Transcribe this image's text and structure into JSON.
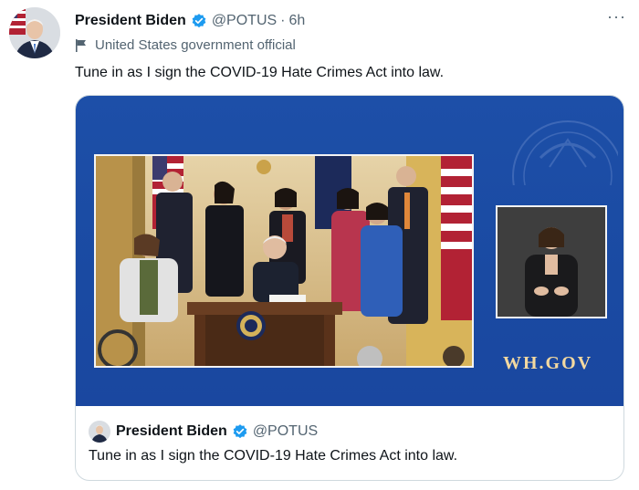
{
  "tweet": {
    "author_name": "President Biden",
    "handle": "@POTUS",
    "separator": "·",
    "time": "6h",
    "more_label": "···",
    "account_label": "United States government official",
    "text": "Tune in as I sign the COVID-19 Hate Crimes Act into law."
  },
  "media": {
    "brand_text": "WH.GOV"
  },
  "quoted": {
    "author_name": "President Biden",
    "handle": "@POTUS",
    "text": "Tune in as I sign the COVID-19 Hate Crimes Act into law."
  },
  "colors": {
    "verified": "#1d9bf0",
    "media_background": "#1d4fa8",
    "secondary_text": "#536471"
  },
  "icons": [
    "verified-badge-icon",
    "government-flag-icon",
    "more-options-icon"
  ]
}
